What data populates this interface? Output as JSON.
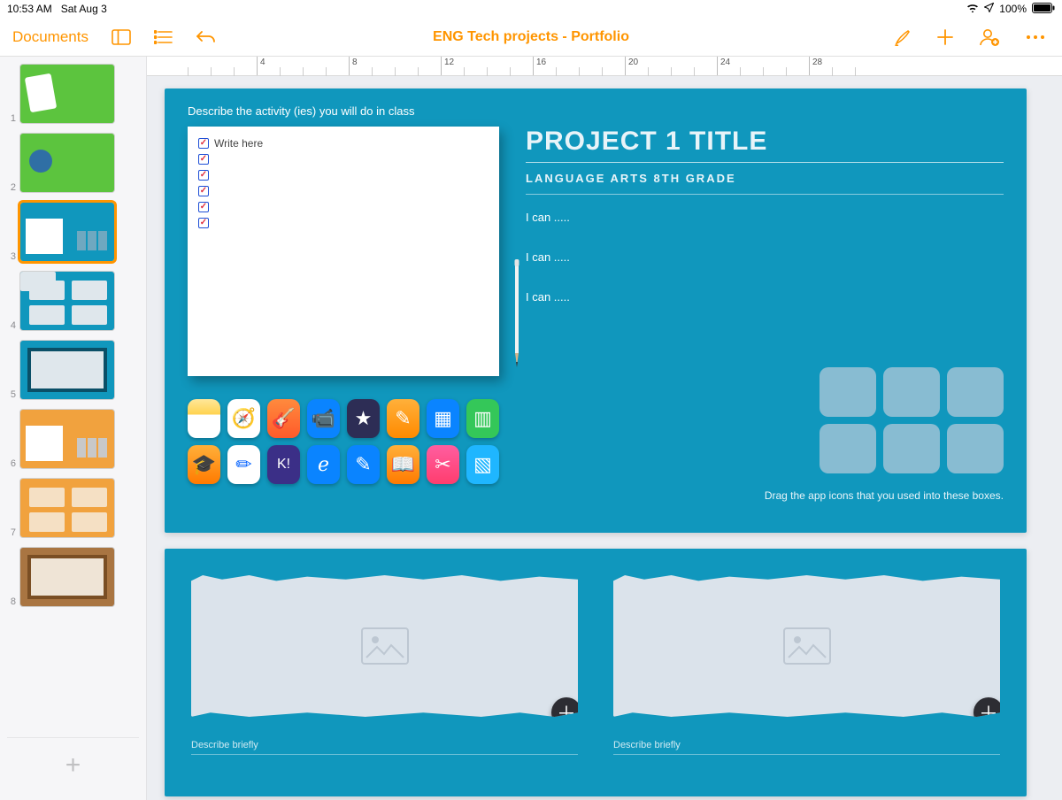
{
  "status": {
    "time": "10:53 AM",
    "date": "Sat Aug 3",
    "battery": "100%"
  },
  "toolbar": {
    "documents": "Documents",
    "title": "ENG Tech projects - Portfolio"
  },
  "sidebar": {
    "slides": [
      "1",
      "2",
      "3",
      "4",
      "5",
      "6",
      "7",
      "8"
    ],
    "selected_index": 2
  },
  "ruler": {
    "majors": [
      4,
      8,
      12,
      16,
      20,
      24,
      28
    ]
  },
  "slide": {
    "prompt": "Describe the activity (ies) you will do in class",
    "write_placeholder": "Write here",
    "title": "PROJECT 1 TITLE",
    "subtitle": "LANGUAGE ARTS 8TH GRADE",
    "ican": [
      "I can .....",
      "I can .....",
      "I can ....."
    ],
    "drag_hint": "Drag the app icons that you used into these boxes.",
    "apps_row1": [
      {
        "name": "notes-app-icon",
        "bg": "linear-gradient(#ffe79a,#ffd24d 40%,#fff 40%)",
        "glyph": ""
      },
      {
        "name": "safari-app-icon",
        "bg": "#fff",
        "glyph": "🧭"
      },
      {
        "name": "garageband-app-icon",
        "bg": "linear-gradient(#ff8a3d,#ff5a2a)",
        "glyph": "🎸"
      },
      {
        "name": "clips-app-icon",
        "bg": "#0a84ff",
        "glyph": "📹"
      },
      {
        "name": "imovie-app-icon",
        "bg": "#2d2d55",
        "glyph": "★"
      },
      {
        "name": "pages-app-icon",
        "bg": "linear-gradient(#ffb03a,#ff8a00)",
        "glyph": "✎"
      },
      {
        "name": "keynote-app-icon",
        "bg": "#0a84ff",
        "glyph": "▦"
      },
      {
        "name": "numbers-app-icon",
        "bg": "#34c759",
        "glyph": "▥"
      }
    ],
    "apps_row2": [
      {
        "name": "itunesu-app-icon",
        "bg": "linear-gradient(#ffb03a,#ff7a00)",
        "glyph": "🎓"
      },
      {
        "name": "marker-app-icon",
        "bg": "#fff",
        "glyph": "✏︎",
        "fg": "#0a66ff"
      },
      {
        "name": "kahoot-app-icon",
        "bg": "#3b2f87",
        "glyph": "K!",
        "fs": "16"
      },
      {
        "name": "edmodo-app-icon",
        "bg": "#0a84ff",
        "glyph": "ℯ"
      },
      {
        "name": "notability-app-icon",
        "bg": "#0a84ff",
        "glyph": "✎"
      },
      {
        "name": "ibooks-app-icon",
        "bg": "linear-gradient(#ffb03a,#ff7a00)",
        "glyph": "📖"
      },
      {
        "name": "screenshot-app-icon",
        "bg": "linear-gradient(#ff5ea0,#ff3d6e)",
        "glyph": "✂"
      },
      {
        "name": "nearpod-app-icon",
        "bg": "#1fb6ff",
        "glyph": "▧"
      }
    ]
  },
  "slide2": {
    "describe": "Describe briefly"
  }
}
